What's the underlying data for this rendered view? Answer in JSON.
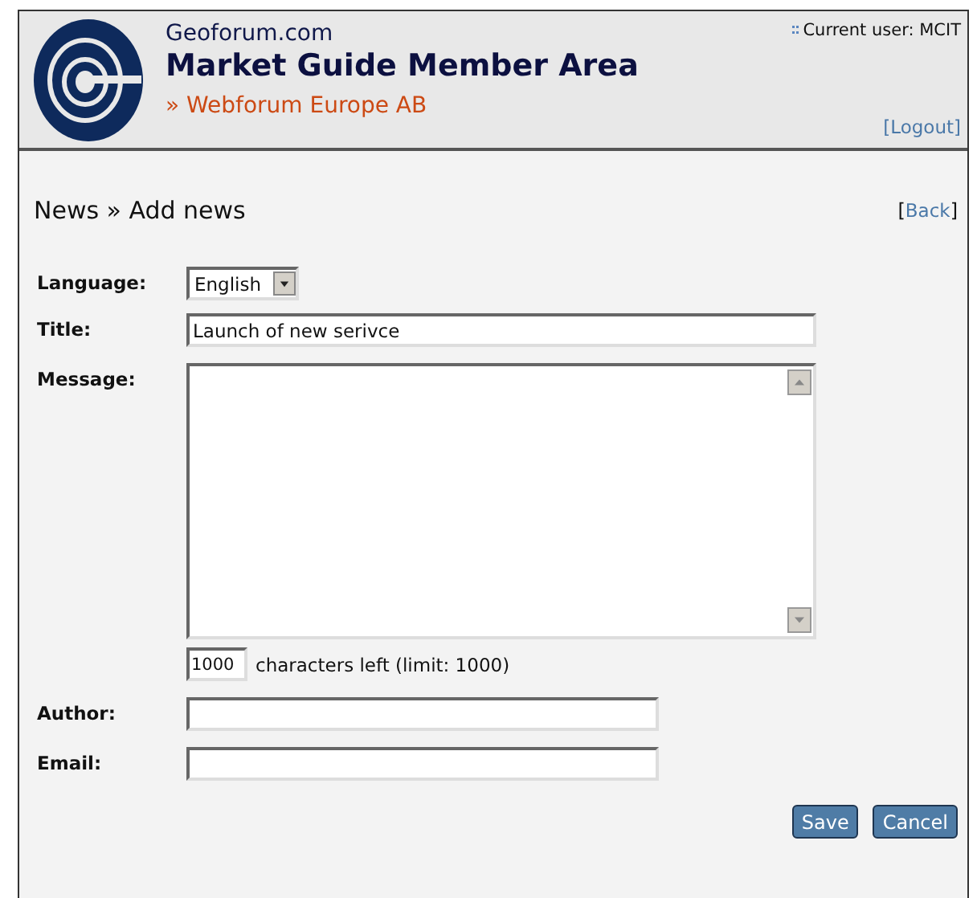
{
  "header": {
    "site": "Geoforum.com",
    "title": "Market Guide Member Area",
    "company": "» Webforum Europe AB",
    "current_user": "Current user: MCIT",
    "logout": "[Logout]"
  },
  "breadcrumb": "News » Add news",
  "back": {
    "open": "[",
    "link": "Back",
    "close": "]"
  },
  "form": {
    "language": {
      "label": "Language:",
      "value": "English"
    },
    "title": {
      "label": "Title:",
      "value": "Launch of new serivce"
    },
    "message": {
      "label": "Message:"
    },
    "counter": {
      "value": "1000",
      "text": "characters left (limit: 1000)"
    },
    "author": {
      "label": "Author:"
    },
    "email": {
      "label": "Email:"
    }
  },
  "buttons": [
    "Save",
    "Cancel"
  ]
}
